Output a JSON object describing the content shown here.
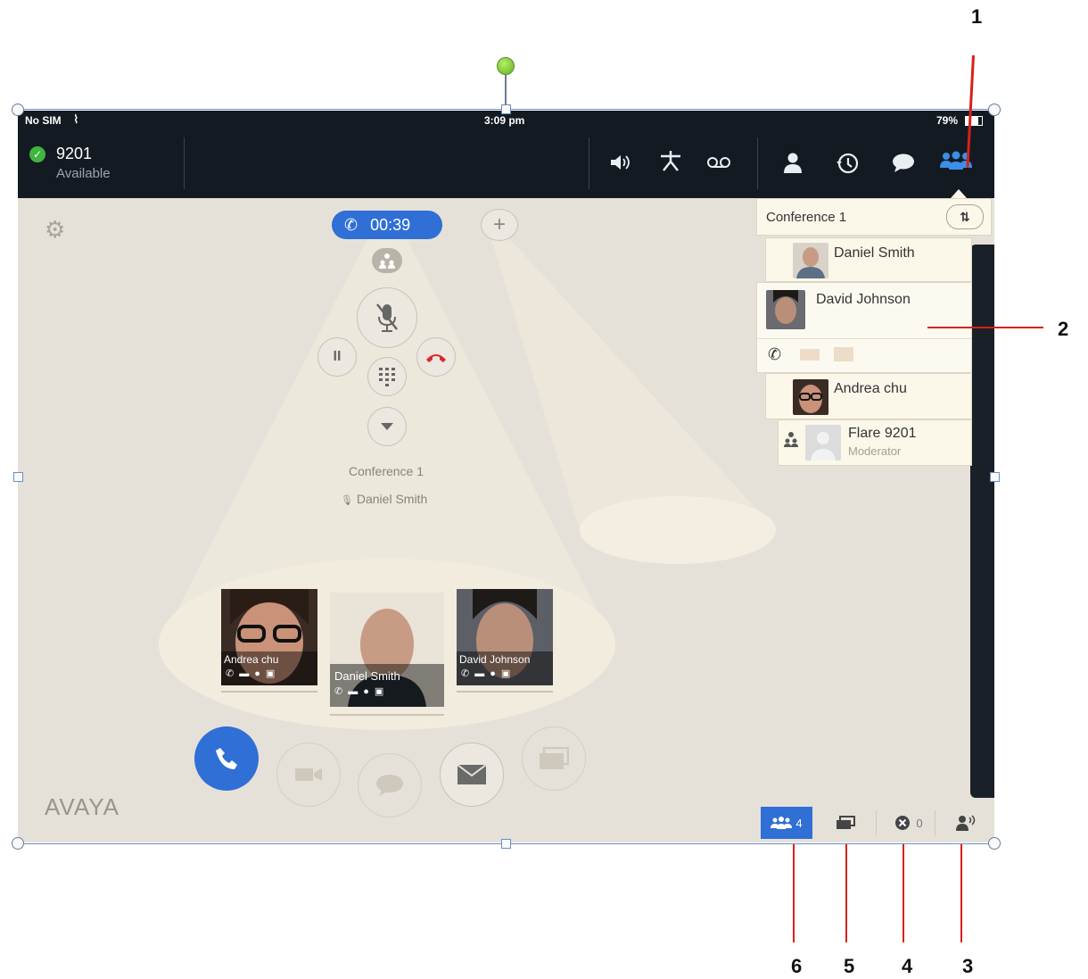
{
  "status_bar": {
    "carrier": "No SIM",
    "time": "3:09 pm",
    "battery": "79%"
  },
  "user": {
    "extension": "9201",
    "presence": "Available"
  },
  "call": {
    "timer": "00:39",
    "conference_name": "Conference 1",
    "active_speaker": "Daniel Smith"
  },
  "participant_tiles": [
    {
      "name": "Andrea chu"
    },
    {
      "name": "Daniel Smith"
    },
    {
      "name": "David Johnson"
    }
  ],
  "roster": {
    "title": "Conference 1",
    "participants": [
      {
        "name": "Daniel Smith"
      },
      {
        "name": "David Johnson"
      },
      {
        "name": "Andrea chu"
      },
      {
        "name": "Flare 9201",
        "role": "Moderator"
      }
    ]
  },
  "bottom_bar": {
    "participants_count": "4",
    "dropped_count": "0"
  },
  "brand": {
    "logo_text": "AVAYA"
  },
  "callouts": [
    "1",
    "2",
    "3",
    "4",
    "5",
    "6"
  ],
  "colors": {
    "accent_blue": "#2f6fd6",
    "topbar": "#141a22",
    "background": "#e6e1d8",
    "hangup_red": "#e0262b",
    "presence_green": "#3fb63f",
    "callout_red": "#d9201a"
  }
}
